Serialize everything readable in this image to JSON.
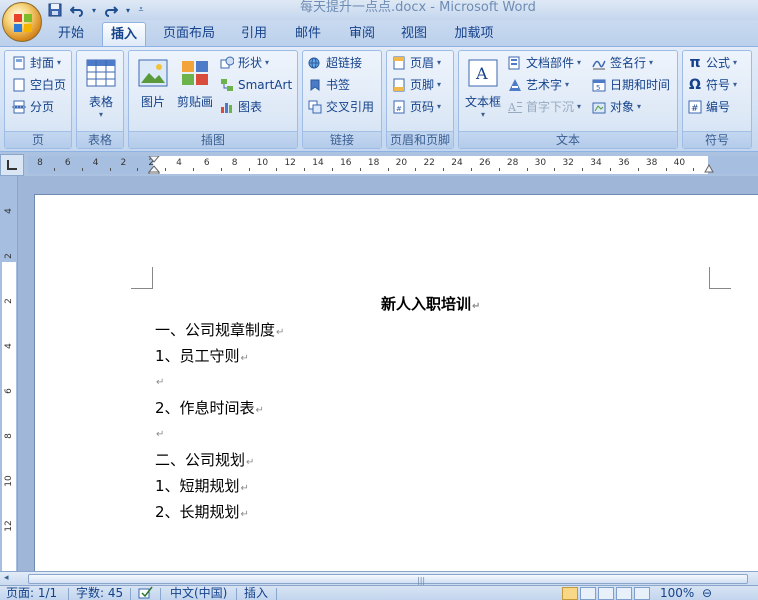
{
  "window": {
    "title": "每天提升一点点.docx - Microsoft Word"
  },
  "qat": {
    "save_icon": "save-icon",
    "undo_icon": "undo-icon",
    "redo_icon": "redo-icon",
    "customize_icon": "customize-icon"
  },
  "tabs": [
    {
      "label": "开始"
    },
    {
      "label": "插入"
    },
    {
      "label": "页面布局"
    },
    {
      "label": "引用"
    },
    {
      "label": "邮件"
    },
    {
      "label": "审阅"
    },
    {
      "label": "视图"
    },
    {
      "label": "加载项"
    }
  ],
  "active_tab": "插入",
  "ribbon": {
    "page_group": {
      "label": "页",
      "cover": "封面",
      "blank": "空白页",
      "page_break": "分页"
    },
    "table_group": {
      "label": "表格",
      "table": "表格"
    },
    "illustrations_group": {
      "label": "插图",
      "picture": "图片",
      "clipart": "剪贴画",
      "shapes": "形状",
      "smartart": "SmartArt",
      "chart": "图表"
    },
    "links_group": {
      "label": "链接",
      "hyperlink": "超链接",
      "bookmark": "书签",
      "cross_ref": "交叉引用"
    },
    "header_footer_group": {
      "label": "页眉和页脚",
      "header": "页眉",
      "footer": "页脚",
      "page_number": "页码"
    },
    "text_group": {
      "label": "文本",
      "textbox": "文本框",
      "quickparts": "文档部件",
      "wordart": "艺术字",
      "dropcap": "首字下沉",
      "signature": "签名行",
      "datetime": "日期和时间",
      "object": "对象"
    },
    "symbols_group": {
      "label": "符号",
      "equation": "公式",
      "symbol": "符号",
      "number": "编号"
    }
  },
  "hruler": {
    "ticks": [
      "8",
      "6",
      "4",
      "2",
      "2",
      "4",
      "6",
      "8",
      "10",
      "12",
      "14",
      "16",
      "18",
      "20",
      "22",
      "24",
      "26",
      "28",
      "30",
      "32",
      "34",
      "36",
      "38",
      "40"
    ]
  },
  "vruler": {
    "ticks": [
      "4",
      "2",
      "2",
      "4",
      "6",
      "8",
      "10",
      "12"
    ]
  },
  "document": {
    "title": "新人入职培训",
    "lines": [
      "一、公司规章制度",
      "1、员工守则",
      "",
      "2、作息时间表",
      "",
      "二、公司规划",
      "1、短期规划",
      "2、长期规划"
    ],
    "para_mark": "↵"
  },
  "statusbar": {
    "page": "页面: 1/1",
    "words": "字数: 45",
    "language": "中文(中国)",
    "mode": "插入",
    "zoom": "100%"
  }
}
